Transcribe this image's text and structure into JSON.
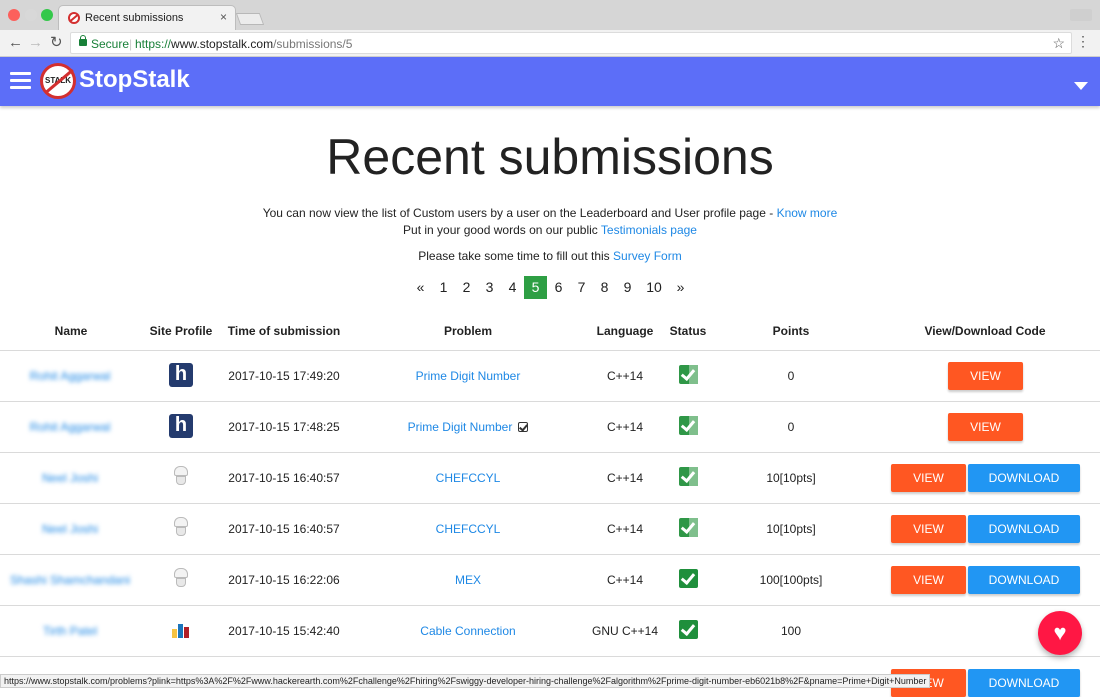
{
  "browser": {
    "tab_title": "Recent submissions",
    "tab_close": "×",
    "secure_label": "Secure",
    "url_scheme": "https://",
    "url_host": "www.stopstalk.com",
    "url_path": "/submissions/5",
    "status_url": "https://www.stopstalk.com/problems?plink=https%3A%2F%2Fwww.hackerearth.com%2Fchallenge%2Fhiring%2Fswiggy-developer-hiring-challenge%2Falgorithm%2Fprime-digit-number-eb6021b8%2F&pname=Prime+Digit+Number"
  },
  "app": {
    "brand": "StopStalk",
    "logo_text": "STALK",
    "bar_color": "#5c6ef8"
  },
  "page": {
    "title": "Recent submissions",
    "notice_line1": "You can now view the list of Custom users by a user on the Leaderboard and User profile page - ",
    "notice_link1": "Know more",
    "notice_line2": "Put in your good words on our public ",
    "notice_link2": "Testimonials page",
    "survey_line": "Please take some time to fill out this ",
    "survey_link": "Survey Form"
  },
  "pagination": {
    "prev": "«",
    "next": "»",
    "pages": [
      "1",
      "2",
      "3",
      "4",
      "5",
      "6",
      "7",
      "8",
      "9",
      "10"
    ],
    "active": "5"
  },
  "table": {
    "headers": {
      "name": "Name",
      "site": "Site Profile",
      "time": "Time of submission",
      "problem": "Problem",
      "language": "Language",
      "status": "Status",
      "points": "Points",
      "code": "View/Download Code"
    },
    "view_label": "VIEW",
    "download_label": "DOWNLOAD",
    "rows": [
      {
        "name": "Rohit Aggarwal",
        "site": "hackerearth",
        "time": "2017-10-15 17:49:20",
        "problem": "Prime Digit Number",
        "language": "C++14",
        "status": "accepted",
        "points": "0"
      },
      {
        "name": "Rohit Aggarwal",
        "site": "hackerearth",
        "time": "2017-10-15 17:48:25",
        "problem": "Prime Digit Number",
        "language": "C++14",
        "status": "accepted",
        "points": "0"
      },
      {
        "name": "Neel Joshi",
        "site": "codechef",
        "time": "2017-10-15 16:40:57",
        "problem": "CHEFCCYL",
        "language": "C++14",
        "status": "accepted",
        "points": "10[10pts]"
      },
      {
        "name": "Neel Joshi",
        "site": "codechef",
        "time": "2017-10-15 16:40:57",
        "problem": "CHEFCCYL",
        "language": "C++14",
        "status": "accepted",
        "points": "10[10pts]"
      },
      {
        "name": "Shashi Shamchandani",
        "site": "codechef",
        "time": "2017-10-15 16:22:06",
        "problem": "MEX",
        "language": "C++14",
        "status": "accepted",
        "points": "100[100pts]"
      },
      {
        "name": "Tirth Patel",
        "site": "codeforces",
        "time": "2017-10-15 15:42:40",
        "problem": "Cable Connection",
        "language": "GNU C++14",
        "status": "accepted",
        "points": "100"
      }
    ]
  },
  "colors": {
    "view": "#ff5722",
    "download": "#2196f3",
    "active_page": "#2e9f44",
    "fab": "#ff1744",
    "link": "#1e88e5"
  },
  "icons": {
    "fab": "heart-icon",
    "hackerearth_letter": "h"
  }
}
